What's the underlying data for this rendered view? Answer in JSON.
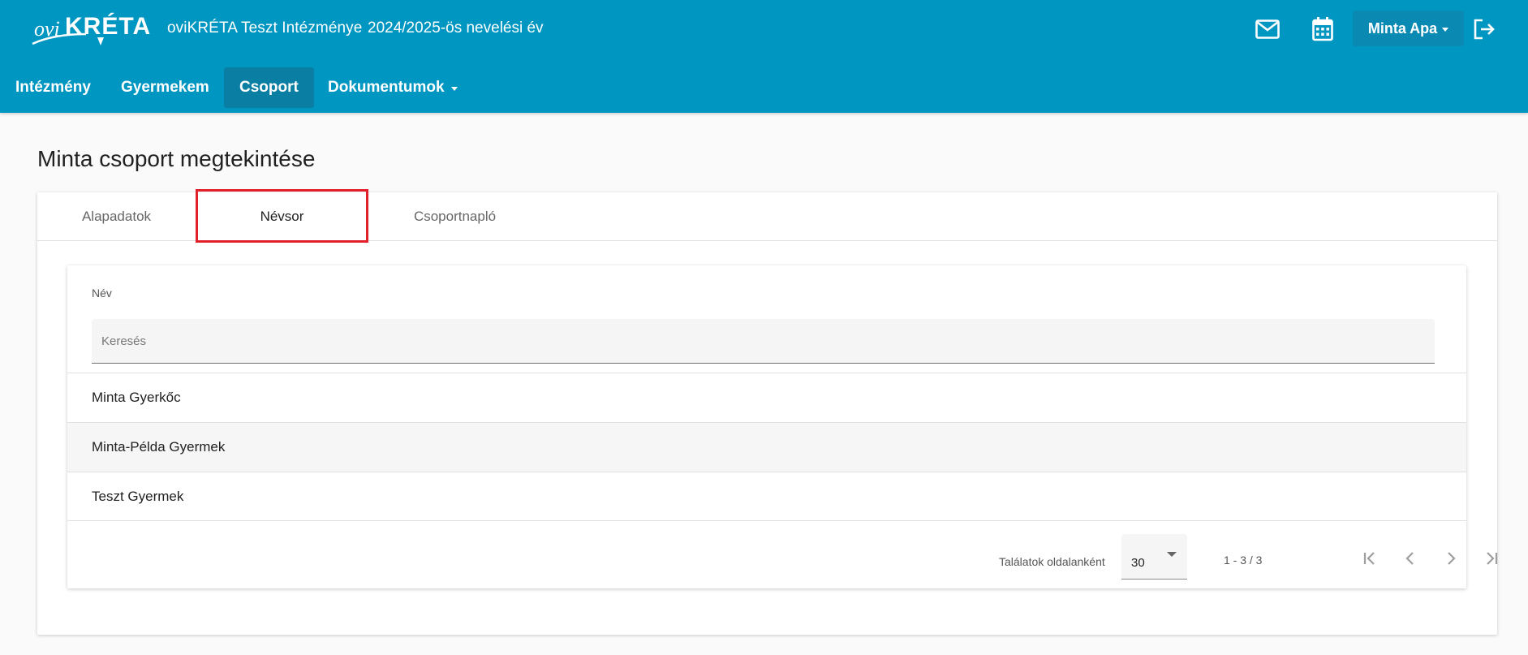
{
  "header": {
    "logo_text": "oviKRÉTA",
    "institution": "oviKRÉTA Teszt Intézménye",
    "school_year": "2024/2025-ös nevelési év",
    "user_name": "Minta Apa",
    "icons": [
      "mail-icon",
      "calendar-icon",
      "logout-icon"
    ]
  },
  "nav": {
    "items": [
      {
        "label": "Intézmény"
      },
      {
        "label": "Gyermekem"
      },
      {
        "label": "Csoport",
        "active": true
      },
      {
        "label": "Dokumentumok",
        "dropdown": true
      }
    ]
  },
  "page": {
    "title": "Minta csoport megtekintése"
  },
  "tabs": [
    {
      "label": "Alapadatok"
    },
    {
      "label": "Névsor",
      "active": true
    },
    {
      "label": "Csoportnapló"
    }
  ],
  "table": {
    "column": "Név",
    "search_placeholder": "Keresés",
    "rows": [
      "Minta Gyerkőc",
      "Minta-Példa Gyermek",
      "Teszt Gyermek"
    ]
  },
  "pagination": {
    "label": "Találatok oldalanként",
    "page_size": "30",
    "range": "1 - 3 / 3"
  },
  "colors": {
    "primary": "#0096c2",
    "highlight": "#e0202a"
  }
}
